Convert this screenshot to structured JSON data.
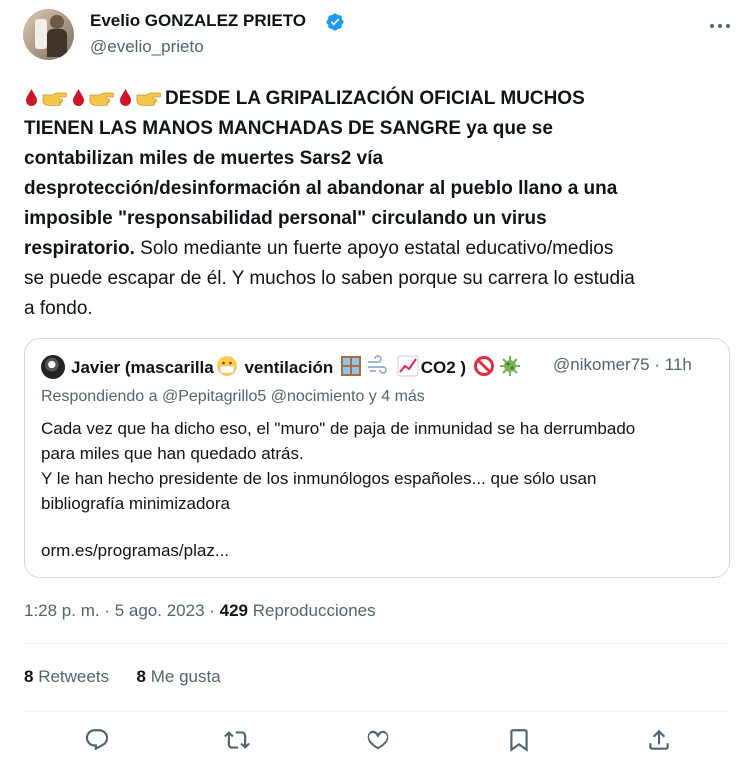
{
  "author": {
    "display_name": "Evelio GONZALEZ PRIETO",
    "handle": "@evelio_prieto",
    "verified": true
  },
  "icons": {
    "more": "more-horizontal-icon",
    "verified": "verified-badge-icon",
    "reply": "reply-icon",
    "retweet": "retweet-icon",
    "like": "like-icon",
    "bookmark": "bookmark-icon",
    "share": "share-icon"
  },
  "body": {
    "line1": "DESDE LA GRIPALIZACIÓN OFICIAL MUCHOS",
    "line2": "TIENEN LAS MANOS MANCHADAS DE SANGRE ya que se",
    "line3": "contabilizan miles de muertes Sars2 vía",
    "line4": "desprotección/desinformación al abandonar al pueblo llano a una",
    "line5": "imposible \"responsabilidad personal\" circulando un virus",
    "line6_bold": "respiratorio.",
    "line6_rest": " Solo mediante un fuerte apoyo estatal educativo/medios",
    "line7": "se puede escapar de él. Y muchos lo saben porque su carrera lo estudia",
    "line8": "a fondo."
  },
  "quote": {
    "name_part1": "Javier (mascarilla",
    "name_part2": " ventilación",
    "name_part3": "CO2 )",
    "handle": "@nikomer75",
    "time": "11h",
    "reply_to": "Respondiendo a @Pepitagrillo5 @nocimiento y 4 más",
    "text_line1": "Cada vez que ha dicho eso, el \"muro\" de paja de inmunidad se ha derrumbado",
    "text_line2": "para miles que han quedado atrás.",
    "text_line3": "Y le han hecho presidente de los inmunólogos españoles... que sólo usan",
    "text_line4": "bibliografía minimizadora",
    "link": "orm.es/programas/plaz..."
  },
  "meta": {
    "time": "1:28 p. m.",
    "date": "5 ago. 2023",
    "views_count": "429",
    "views_label": "Reproducciones"
  },
  "stats": {
    "retweets_count": "8",
    "retweets_label": "Retweets",
    "likes_count": "8",
    "likes_label": "Me gusta"
  },
  "colors": {
    "text": "#0f1419",
    "secondary": "#536471",
    "verified": "#1d9bf0",
    "border": "#cfd9de",
    "divider": "#eff3f4",
    "drop": "#d0152a",
    "hand": "#f5c84c"
  }
}
